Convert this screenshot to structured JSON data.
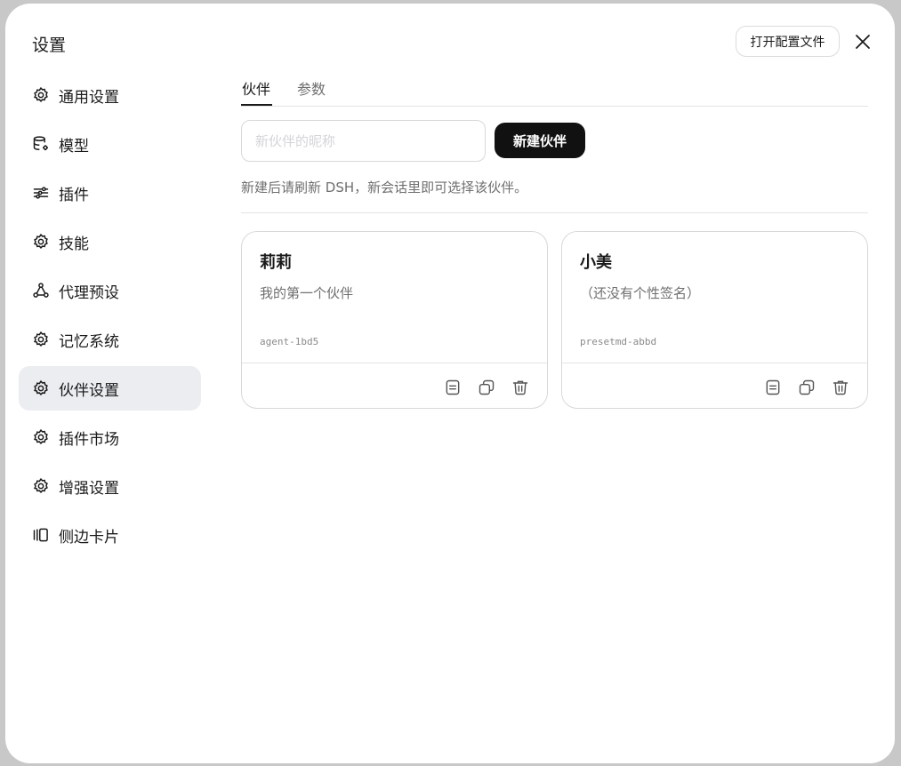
{
  "dialog": {
    "title": "设置",
    "open_config_label": "打开配置文件",
    "close_icon": "close-icon"
  },
  "sidebar": {
    "items": [
      {
        "label": "通用设置",
        "icon": "gear-icon",
        "active": false
      },
      {
        "label": "模型",
        "icon": "database-gear-icon",
        "active": false
      },
      {
        "label": "插件",
        "icon": "sliders-icon",
        "active": false
      },
      {
        "label": "技能",
        "icon": "gear-icon",
        "active": false
      },
      {
        "label": "代理预设",
        "icon": "share-nodes-icon",
        "active": false
      },
      {
        "label": "记忆系统",
        "icon": "gear-icon",
        "active": false
      },
      {
        "label": "伙伴设置",
        "icon": "gear-icon",
        "active": true
      },
      {
        "label": "插件市场",
        "icon": "gear-icon",
        "active": false
      },
      {
        "label": "增强设置",
        "icon": "gear-icon",
        "active": false
      },
      {
        "label": "侧边卡片",
        "icon": "side-cards-icon",
        "active": false
      }
    ]
  },
  "main": {
    "tabs": [
      {
        "label": "伙伴",
        "active": true
      },
      {
        "label": "参数",
        "active": false
      }
    ],
    "name_input": {
      "placeholder": "新伙伴的昵称",
      "value": ""
    },
    "new_button_label": "新建伙伴",
    "hint": "新建后请刷新 DSH，新会话里即可选择该伙伴。",
    "cards": [
      {
        "name": "莉莉",
        "signature": "我的第一个伙伴",
        "id": "agent-1bd5"
      },
      {
        "name": "小美",
        "signature": "（还没有个性签名）",
        "id": "presetmd-abbd"
      }
    ],
    "card_actions": [
      "document-icon",
      "copy-icon",
      "trash-icon"
    ]
  },
  "colors": {
    "accent": "#111111",
    "active_nav_bg": "#ebedf0",
    "muted_text": "#6f6f6f",
    "border": "#d8d8d8"
  }
}
